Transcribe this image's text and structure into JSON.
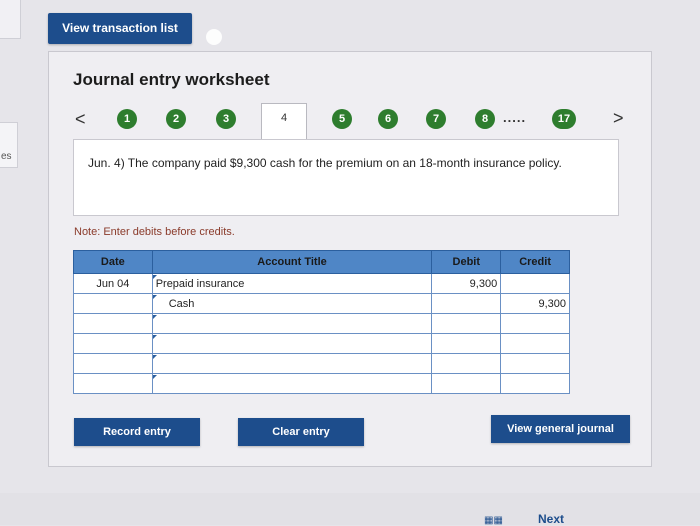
{
  "top": {
    "view_transaction_list": "View transaction list"
  },
  "side_fragment": "es",
  "worksheet": {
    "title": "Journal entry worksheet",
    "prev_arrow": "<",
    "next_arrow": ">",
    "steps": [
      "1",
      "2",
      "3",
      "4",
      "5",
      "6",
      "7",
      "8",
      "17"
    ],
    "active_step": "4",
    "ellipsis": ".....",
    "question": "Jun. 4) The company paid $9,300 cash for the premium on an 18-month insurance policy.",
    "note": "Note: Enter debits before credits.",
    "table": {
      "headers": {
        "date": "Date",
        "account": "Account Title",
        "debit": "Debit",
        "credit": "Credit"
      },
      "rows": [
        {
          "date": "Jun 04",
          "account": "Prepaid insurance",
          "debit": "9,300",
          "credit": ""
        },
        {
          "date": "",
          "account": "Cash",
          "debit": "",
          "credit": "9,300"
        },
        {
          "date": "",
          "account": "",
          "debit": "",
          "credit": ""
        },
        {
          "date": "",
          "account": "",
          "debit": "",
          "credit": ""
        },
        {
          "date": "",
          "account": "",
          "debit": "",
          "credit": ""
        },
        {
          "date": "",
          "account": "",
          "debit": "",
          "credit": ""
        }
      ]
    },
    "buttons": {
      "record": "Record entry",
      "clear": "Clear entry",
      "view_journal": "View general journal"
    }
  },
  "bottom": {
    "next": "Next"
  },
  "colors": {
    "button": "#1d4d8c",
    "step": "#2e7d2e",
    "table_header": "#4f86c6"
  }
}
